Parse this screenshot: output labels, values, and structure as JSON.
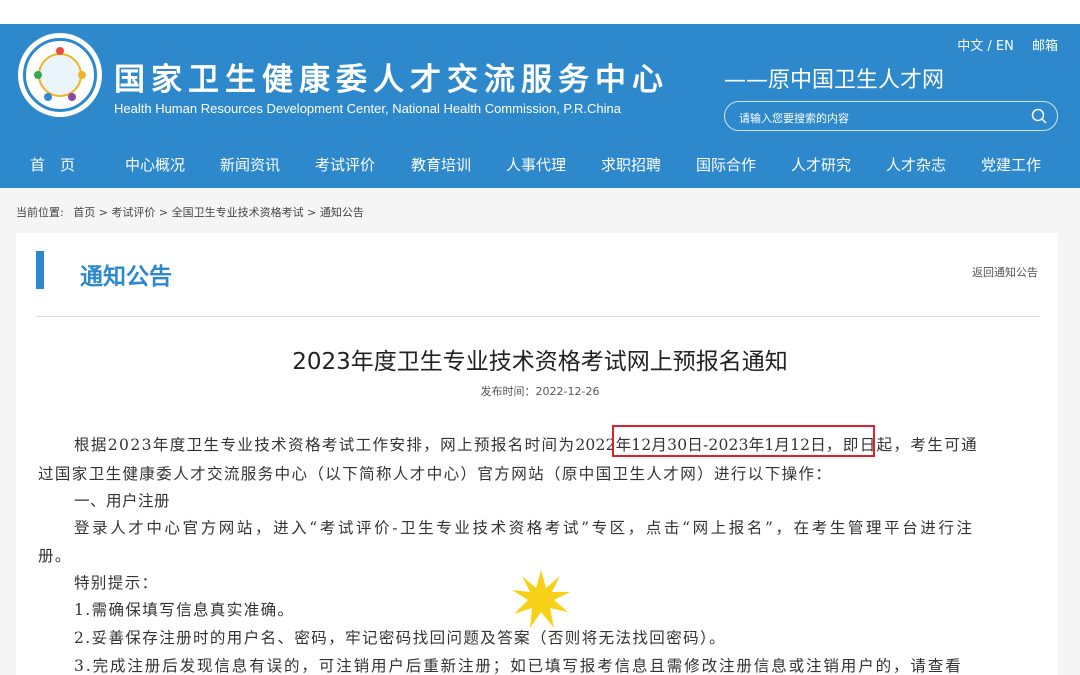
{
  "header": {
    "title": "国家卫生健康委人才交流服务中心",
    "subtitle": "Health Human Resources Development Center, National Health Commission, P.R.China",
    "former_name": "——原中国卫生人才网",
    "lang_switch": "中文 / EN",
    "mail": "邮箱",
    "logo_icon": "emblem-logo-icon",
    "search_placeholder": "请输入您要搜索的内容"
  },
  "nav": {
    "items": [
      "首　页",
      "中心概况",
      "新闻资讯",
      "考试评价",
      "教育培训",
      "人事代理",
      "求职招聘",
      "国际合作",
      "人才研究",
      "人才杂志",
      "党建工作"
    ]
  },
  "breadcrumb": {
    "label": "当前位置:",
    "path": "首页 > 考试评价 > 全国卫生专业技术资格考试 > 通知公告"
  },
  "panel": {
    "title": "通知公告",
    "back_link": "返回通知公告"
  },
  "article": {
    "title": "2023年度卫生专业技术资格考试网上预报名通知",
    "date": "发布时间：2022-12-26",
    "para1_line1_pre": "根据2023年度卫生专业技术资格考试工作安排，网上预报名时间为",
    "para1_highlight": "2022年12月30日-2023年1月12日",
    "para1_line1_post": "，即日起，考生可通",
    "para1_line2": "过国家卫生健康委人才交流服务中心（以下简称人才中心）官方网站（原中国卫生人才网）进行以下操作：",
    "section1": "一、用户注册",
    "reg_line1": "登录人才中心官方网站，进入“考试评价-卫生专业技术资格考试”专区，点击“网上报名”，在考生管理平台进行注",
    "reg_line2": "册。",
    "tip_head": "特别提示：",
    "tip1": "1.需确保填写信息真实准确。",
    "tip2": "2.妥善保存注册时的用户名、密码，牢记密码找回问题及答案（否则将无法找回密码）。",
    "tip3": "3.完成注册后发现信息有误的，可注销用户后重新注册；如已填写报考信息且需修改注册信息或注销用户的，请查看"
  },
  "colors": {
    "brand_blue": "#2e89cc",
    "highlight_red": "#d9232d",
    "burst_yellow": "#f7d117"
  }
}
